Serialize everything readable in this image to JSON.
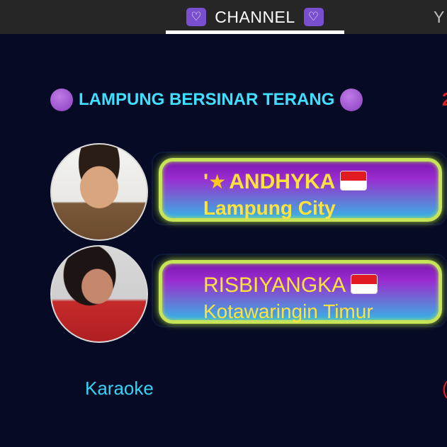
{
  "tabs": {
    "channel_label": "CHANNEL",
    "heart_left": "♡",
    "heart_right": "♡",
    "next_tab_partial": "Y"
  },
  "group": {
    "title": "LAMPUNG BERSINAR TERANG",
    "right_partial": "2"
  },
  "users": [
    {
      "prefix": "'",
      "name": "ANDHYKA",
      "city": "Lampung City"
    },
    {
      "prefix": "",
      "name": "RISBIYANGKA",
      "city": "Kotawaringin Timur"
    }
  ],
  "footer": {
    "label": "Karaoke",
    "right_partial": "("
  },
  "colors": {
    "background": "#060a24",
    "title_cyan": "#3fe0ff",
    "name_yellow": "#ffe23a",
    "card_border_green": "#c7e35a",
    "card_gradient_top": "#7a19b0",
    "card_gradient_bottom": "#35b4e6",
    "dot_purple": "#8a3fc0"
  },
  "icons": [
    "heart-icon",
    "star-icon",
    "indonesia-flag-icon",
    "purple-dot-icon"
  ]
}
